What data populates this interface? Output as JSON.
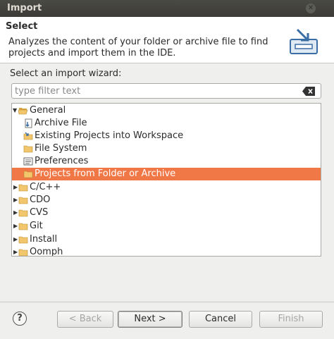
{
  "window": {
    "title": "Import"
  },
  "header": {
    "title": "Select",
    "description": "Analyzes the content of your folder or archive file to find projects and import them in the IDE."
  },
  "wizard_label": "Select an import wizard:",
  "filter": {
    "placeholder": "type filter text",
    "value": ""
  },
  "tree": {
    "items": [
      {
        "label": "General",
        "level": 0,
        "expanded": true,
        "icon": "folder-open-icon"
      },
      {
        "label": "Archive File",
        "level": 1,
        "icon": "archive-file-icon"
      },
      {
        "label": "Existing Projects into Workspace",
        "level": 1,
        "icon": "existing-projects-icon"
      },
      {
        "label": "File System",
        "level": 1,
        "icon": "folder-icon"
      },
      {
        "label": "Preferences",
        "level": 1,
        "icon": "preferences-icon"
      },
      {
        "label": "Projects from Folder or Archive",
        "level": 1,
        "icon": "folder-icon",
        "selected": true
      },
      {
        "label": "C/C++",
        "level": 0,
        "expanded": false,
        "icon": "folder-icon"
      },
      {
        "label": "CDO",
        "level": 0,
        "expanded": false,
        "icon": "folder-icon"
      },
      {
        "label": "CVS",
        "level": 0,
        "expanded": false,
        "icon": "folder-icon"
      },
      {
        "label": "Git",
        "level": 0,
        "expanded": false,
        "icon": "folder-icon"
      },
      {
        "label": "Install",
        "level": 0,
        "expanded": false,
        "icon": "folder-icon"
      },
      {
        "label": "Oomph",
        "level": 0,
        "expanded": false,
        "icon": "folder-icon"
      }
    ]
  },
  "buttons": {
    "help": "?",
    "back": "< Back",
    "next": "Next >",
    "cancel": "Cancel",
    "finish": "Finish"
  },
  "colors": {
    "selection": "#f07746",
    "titlebar": "#3c3b37"
  }
}
